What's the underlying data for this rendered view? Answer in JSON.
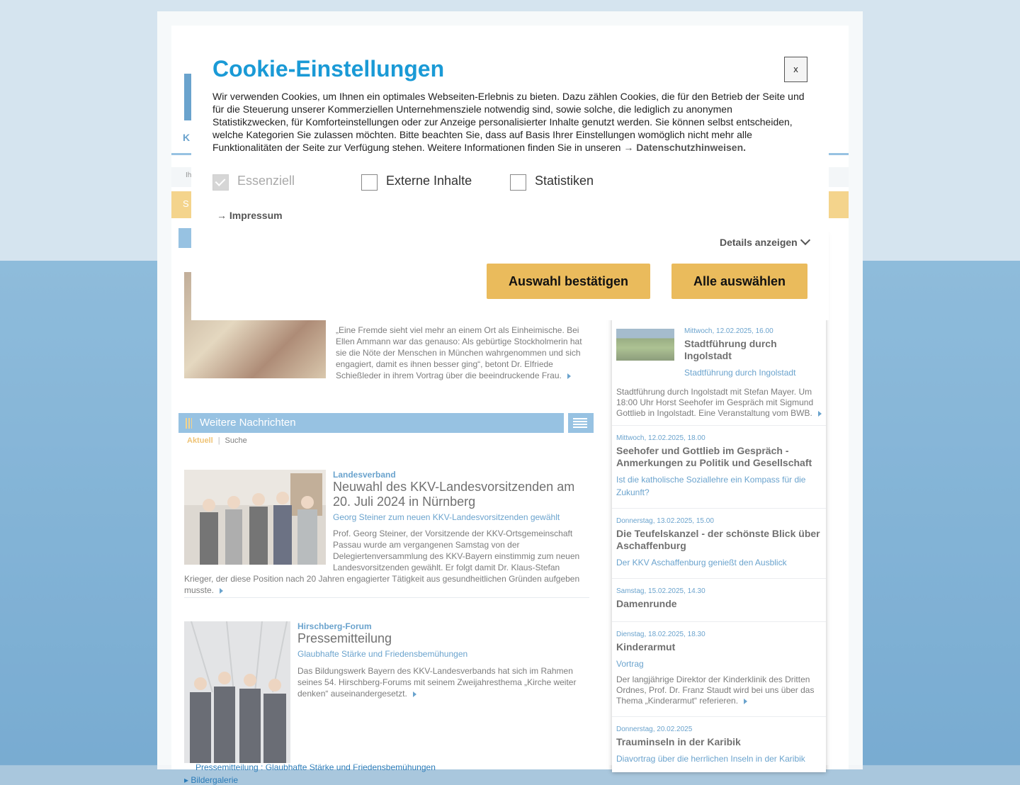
{
  "background": {
    "nav_crumb": "Ih",
    "orange_bar_text": "S",
    "logo_letter": "K",
    "teaser_text": "„Eine Fremde sieht viel mehr an einem Ort als Einheimische. Bei Ellen Ammann war das genauso: Als gebürtige Stockholmerin hat sie die Nöte der Menschen in München wahrgenommen und sich engagiert, damit es ihnen besser ging“, betont Dr. Elfriede Schießleder in ihrem Vortrag über die beeindruckende Frau.",
    "section_title": "Weitere Nachrichten",
    "tabs": [
      {
        "label": "Aktuell"
      },
      {
        "label": "Suche"
      }
    ],
    "articles": [
      {
        "category": "Landesverband",
        "title": "Neuwahl des KKV-Landesvorsitzenden am 20. Juli 2024 in Nürnberg",
        "subtitle": "Georg Steiner zum neuen KKV-Landesvorsitzenden gewählt",
        "body": "Prof. Georg Steiner, der Vorsitzende der KKV-Ortsgemeinschaft Passau wurde am vergangenen Samstag von der Delegiertenversammlung des KKV-Bayern einstimmig zum neuen Landesvorsitzenden gewählt. Er folgt damit Dr. Klaus-Stefan Krieger, der diese Position nach 20 Jahren engagierter Tätigkeit aus gesundheitlichen Gründen aufgeben musste."
      },
      {
        "category": "Hirschberg-Forum",
        "title": "Pressemitteilung",
        "subtitle": "Glaubhafte Stärke und Friedensbemühungen",
        "body": "Das Bildungswerk Bayern des KKV-Landesverbands hat sich im Rahmen seines 54. Hirschberg-Forums mit seinem Zweijahresthema „Kirche weiter denken“ auseinandergesetzt."
      }
    ],
    "bottom_links": [
      "Pressemitteilung : Glaubhafte Stärke und Friedensbemühungen",
      "Bildergalerie"
    ],
    "events": [
      {
        "date": "Mittwoch, 12.02.2025, 16.00",
        "title": "Stadtführung durch Ingolstadt",
        "subtitle": "Stadtführung durch Ingolstadt",
        "body": "Stadtführung durch Ingolstadt mit Stefan Mayer. Um 18:00 Uhr Horst Seehofer im Gespräch mit Sigmund Gottlieb in Ingolstadt. Eine Veranstaltung vom BWB."
      },
      {
        "date": "Mittwoch, 12.02.2025, 18.00",
        "title": "Seehofer und Gottlieb im Gespräch - Anmerkungen zu Politik und Gesellschaft",
        "subtitle": "Ist die katholische Soziallehre ein Kompass für die Zukunft?",
        "body": ""
      },
      {
        "date": "Donnerstag, 13.02.2025, 15.00",
        "title": "Die Teufelskanzel - der schönste Blick über Aschaffenburg",
        "subtitle": "Der KKV Aschaffenburg genießt den Ausblick",
        "body": ""
      },
      {
        "date": "Samstag, 15.02.2025, 14.30",
        "title": "Damenrunde",
        "subtitle": "",
        "body": ""
      },
      {
        "date": "Dienstag, 18.02.2025, 18.30",
        "title": "Kinderarmut",
        "subtitle": "Vortrag",
        "body": "Der langjährige Direktor der Kinderklinik des Dritten Ordnes, Prof. Dr. Franz Staudt wird bei uns über das Thema „Kinderarmut“ referieren."
      },
      {
        "date": "Donnerstag, 20.02.2025",
        "title": "Trauminseln in der Karibik",
        "subtitle": "Diavortrag über die herrlichen Inseln in der Karibik",
        "body": ""
      }
    ]
  },
  "cookie_modal": {
    "title": "Cookie-Einstellungen",
    "close_label": "x",
    "text": "Wir verwenden Cookies, um Ihnen ein optimales Webseiten-Erlebnis zu bieten. Dazu zählen Cookies, die für den Betrieb der Seite und für die Steuerung unserer Kommerziellen Unternehmensziele notwendig sind, sowie solche, die lediglich zu anonymen Statistikzwecken, für Komforteinstellungen oder zur Anzeige personalisierter Inhalte genutzt werden. Sie können selbst entscheiden, welche Kategorien Sie zulassen möchten. Bitte beachten Sie, dass auf Basis Ihrer Einstellungen womöglich nicht mehr alle Funktionalitäten der Seite zur Verfügung stehen. Weitere Informationen finden Sie in unseren",
    "privacy_link": "→ Datenschutzhinweisen.",
    "options": [
      {
        "label": "Essenziell",
        "checked": true,
        "disabled": true
      },
      {
        "label": "Externe Inhalte",
        "checked": false,
        "disabled": false
      },
      {
        "label": "Statistiken",
        "checked": false,
        "disabled": false
      }
    ],
    "impressum_link": "→ Impressum",
    "details_label": "Details anzeigen",
    "confirm_button": "Auswahl bestätigen",
    "select_all_button": "Alle auswählen",
    "colors": {
      "title": "#1a9ad6",
      "button": "#eabb5c"
    }
  }
}
